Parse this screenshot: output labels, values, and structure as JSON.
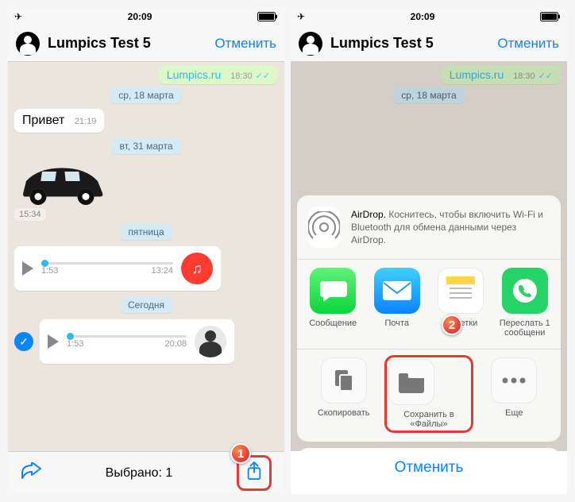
{
  "status": {
    "time": "20:09"
  },
  "header": {
    "title": "Lumpics Test 5",
    "cancel": "Отменить"
  },
  "left": {
    "out_link": "Lumpics.ru",
    "out_link_time": "18:30",
    "date1": "ср, 18 марта",
    "msg_hi": "Привет",
    "msg_hi_time": "21:19",
    "date2": "вт, 31 марта",
    "sticker_time": "15:34",
    "date3": "пятница",
    "voice1_dur": "1:53",
    "voice1_time": "13:24",
    "date4": "Сегодня",
    "voice2_dur": "1:53",
    "voice2_time": "20:08",
    "selected": "Выбрано: 1"
  },
  "sheet": {
    "airdrop_bold": "AirDrop.",
    "airdrop_text": " Коснитесь, чтобы включить Wi-Fi и Bluetooth для обмена данными через AirDrop.",
    "app_message": "Сообщение",
    "app_mail": "Почта",
    "app_notes": "Заметки",
    "app_wa": "Переслать 1 сообщени",
    "act_copy": "Скопировать",
    "act_save": "Сохранить в «Файлы»",
    "act_more": "Еще",
    "cancel": "Отменить"
  },
  "callouts": {
    "one": "1",
    "two": "2"
  }
}
